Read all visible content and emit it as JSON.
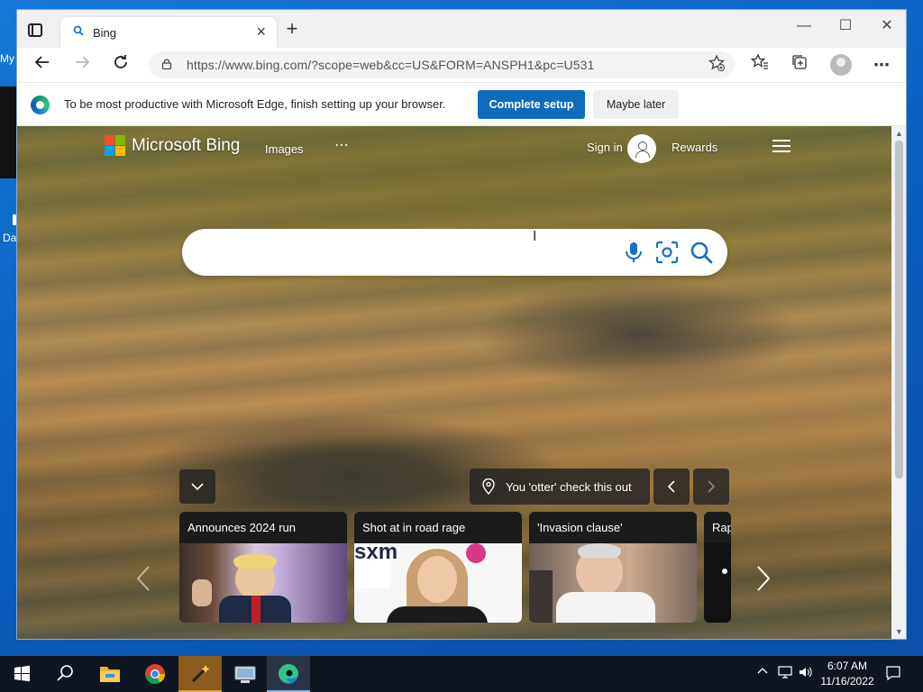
{
  "desktop": {
    "icon_labels": [
      "My",
      "Da"
    ]
  },
  "browser": {
    "tab": {
      "title": "Bing",
      "favicon": "search-icon"
    },
    "address": "https://www.bing.com/?scope=web&cc=US&FORM=ANSPH1&pc=U531",
    "window_controls": {
      "minimize": "—",
      "maximize": "☐",
      "close": "✕"
    },
    "toolbar_icons": [
      "back-icon",
      "forward-icon",
      "refresh-icon",
      "lock-icon",
      "add-favorite-icon",
      "favorites-icon",
      "collections-icon",
      "profile-icon",
      "more-icon"
    ],
    "infobar": {
      "message": "To be most productive with Microsoft Edge, finish setting up your browser.",
      "primary": "Complete setup",
      "secondary": "Maybe later"
    }
  },
  "bing": {
    "brand": "Microsoft Bing",
    "nav": {
      "images": "Images",
      "more": "⋯"
    },
    "sign_in": "Sign in",
    "rewards": "Rewards",
    "search": {
      "value": "",
      "placeholder": ""
    },
    "image_caption": "You 'otter' check this out",
    "news_cards": [
      {
        "title": "Announces 2024 run"
      },
      {
        "title": "Shot at in road rage"
      },
      {
        "title": "'Invasion clause'"
      },
      {
        "title": "Rap"
      }
    ],
    "logo_colors": [
      "#f25022",
      "#7fba00",
      "#00a4ef",
      "#ffb900"
    ]
  },
  "taskbar": {
    "apps": [
      "start-icon",
      "search-icon",
      "file-explorer-icon",
      "chrome-icon",
      "wizard-icon",
      "computer-icon",
      "edge-icon"
    ],
    "time": "6:07 AM",
    "date": "11/16/2022"
  }
}
